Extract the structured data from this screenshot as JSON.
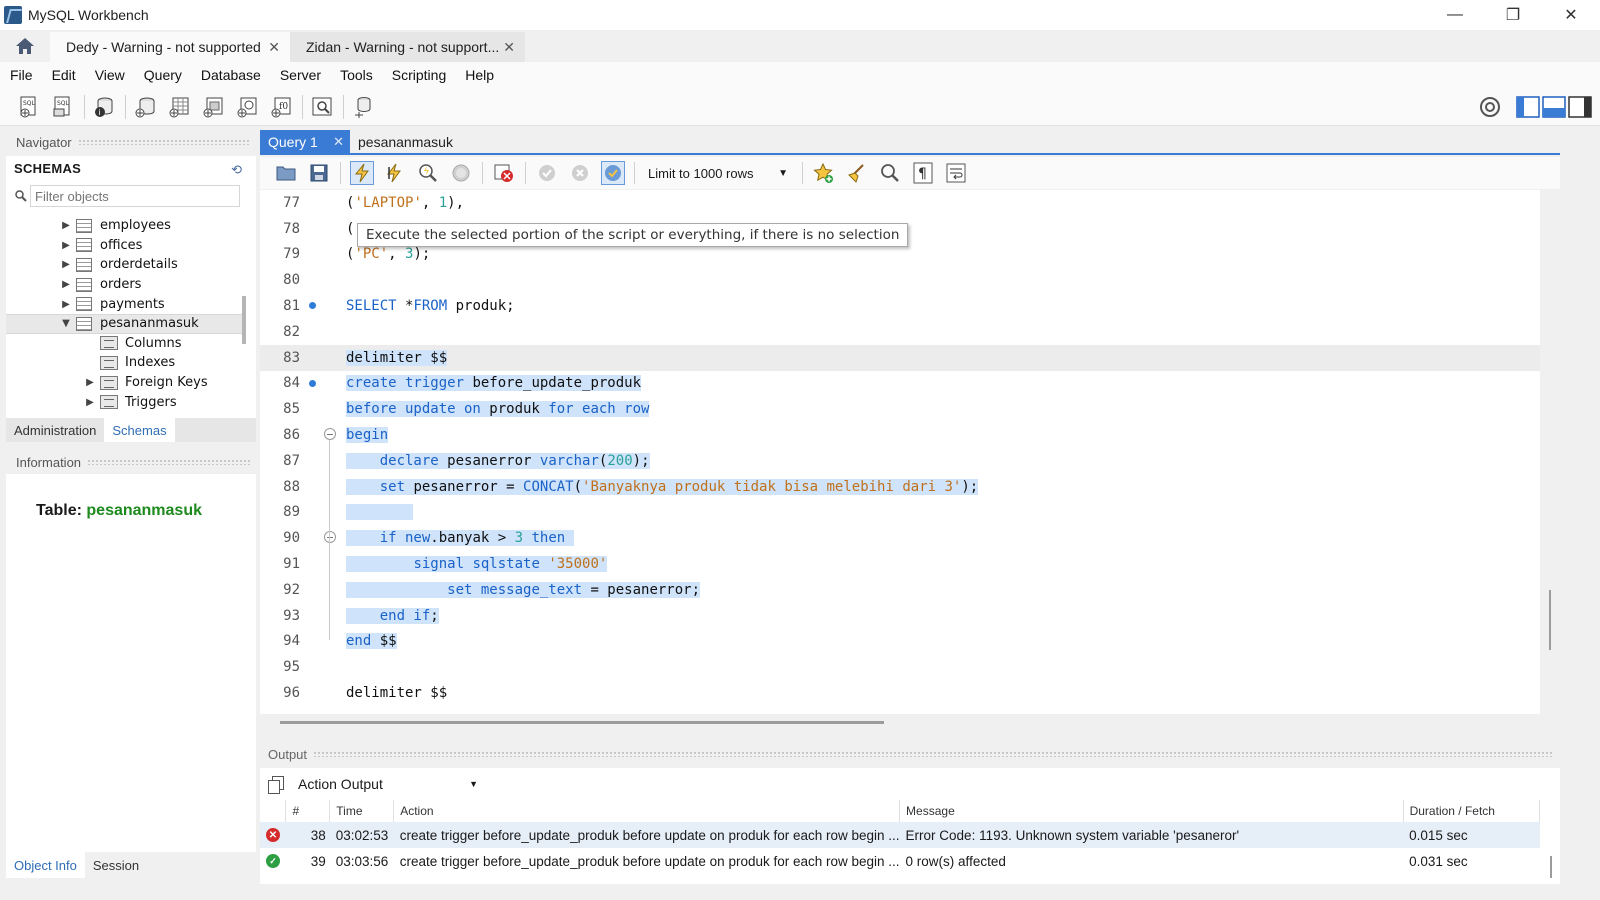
{
  "window": {
    "title": "MySQL Workbench",
    "minimize": "—",
    "maximize": "❐",
    "close": "✕"
  },
  "connection_tabs": [
    {
      "label": "Dedy - Warning - not supported",
      "close": "✕"
    },
    {
      "label": "Zidan - Warning - not support...",
      "close": "✕"
    }
  ],
  "menu": [
    "File",
    "Edit",
    "View",
    "Query",
    "Database",
    "Server",
    "Tools",
    "Scripting",
    "Help"
  ],
  "navigator": {
    "header": "Navigator",
    "schemas_title": "SCHEMAS",
    "filter_placeholder": "Filter objects",
    "tree": [
      {
        "label": "employees",
        "type": "table",
        "expanded": false
      },
      {
        "label": "offices",
        "type": "table",
        "expanded": false
      },
      {
        "label": "orderdetails",
        "type": "table",
        "expanded": false
      },
      {
        "label": "orders",
        "type": "table",
        "expanded": false
      },
      {
        "label": "payments",
        "type": "table",
        "expanded": false
      },
      {
        "label": "pesananmasuk",
        "type": "table",
        "expanded": true,
        "selected": true
      },
      {
        "label": "Columns",
        "type": "folder"
      },
      {
        "label": "Indexes",
        "type": "folder"
      },
      {
        "label": "Foreign Keys",
        "type": "folder",
        "expandable": true
      },
      {
        "label": "Triggers",
        "type": "folder",
        "expandable": true
      }
    ],
    "tabs": [
      "Administration",
      "Schemas"
    ],
    "active_tab": "Schemas",
    "info_header": "Information",
    "info_label": "Table:",
    "info_table": "pesananmasuk",
    "bottom_tabs": [
      "Object Info",
      "Session"
    ],
    "active_bottom_tab": "Object Info"
  },
  "editor": {
    "tabs": [
      {
        "label": "Query 1",
        "active": true,
        "close": "✕"
      },
      {
        "label": "pesananmasuk",
        "active": false
      }
    ],
    "limit": "Limit to 1000 rows",
    "tooltip": "Execute the selected portion of the script or everything, if there is no selection",
    "lines": [
      {
        "n": "77",
        "text": "('LAPTOP', 1),"
      },
      {
        "n": "78",
        "text": "("
      },
      {
        "n": "79",
        "text": "('PC', 3);"
      },
      {
        "n": "80",
        "text": ""
      },
      {
        "n": "81",
        "text": "SELECT *FROM produk;",
        "bp": true
      },
      {
        "n": "82",
        "text": ""
      },
      {
        "n": "83",
        "text": "delimiter $$",
        "current": true,
        "sel": true
      },
      {
        "n": "84",
        "text": "create trigger before_update_produk",
        "bp": true,
        "sel": true
      },
      {
        "n": "85",
        "text": "before update on produk for each row",
        "sel": true
      },
      {
        "n": "86",
        "text": "begin",
        "fold": true,
        "sel": true
      },
      {
        "n": "87",
        "text": "    declare pesanerror varchar(200);",
        "sel": true
      },
      {
        "n": "88",
        "text": "    set pesanerror = CONCAT('Banyaknya produk tidak bisa melebihi dari 3');",
        "sel": true
      },
      {
        "n": "89",
        "text": "",
        "sel": true
      },
      {
        "n": "90",
        "text": "    if new.banyak > 3 then",
        "fold": true,
        "sel": true
      },
      {
        "n": "91",
        "text": "        signal sqlstate '35000'",
        "sel": true
      },
      {
        "n": "92",
        "text": "            set message_text = pesanerror;",
        "sel": true
      },
      {
        "n": "93",
        "text": "    end if;",
        "sel": true
      },
      {
        "n": "94",
        "text": "end $$",
        "sel": true
      },
      {
        "n": "95",
        "text": ""
      },
      {
        "n": "96",
        "text": "delimiter $$"
      }
    ]
  },
  "output": {
    "header": "Output",
    "selector": "Action Output",
    "columns": [
      "",
      "#",
      "Time",
      "Action",
      "Message",
      "Duration / Fetch"
    ],
    "rows": [
      {
        "status": "error",
        "num": "38",
        "time": "03:02:53",
        "action": "create trigger before_update_produk before update on produk for each row begin   ...",
        "message": "Error Code: 1193. Unknown system variable 'pesaneror'",
        "duration": "0.015 sec"
      },
      {
        "status": "ok",
        "num": "39",
        "time": "03:03:56",
        "action": "create trigger before_update_produk before update on produk for each row begin   ...",
        "message": "0 row(s) affected",
        "duration": "0.031 sec"
      }
    ]
  },
  "colors": {
    "accent": "#3a7bd5",
    "selection": "#cfe3fa",
    "keyword": "#1a62c8",
    "string": "#c0701c",
    "number": "#2aa198",
    "table_name": "#1d8a1d",
    "error": "#d62b2b",
    "ok": "#2ea043"
  }
}
